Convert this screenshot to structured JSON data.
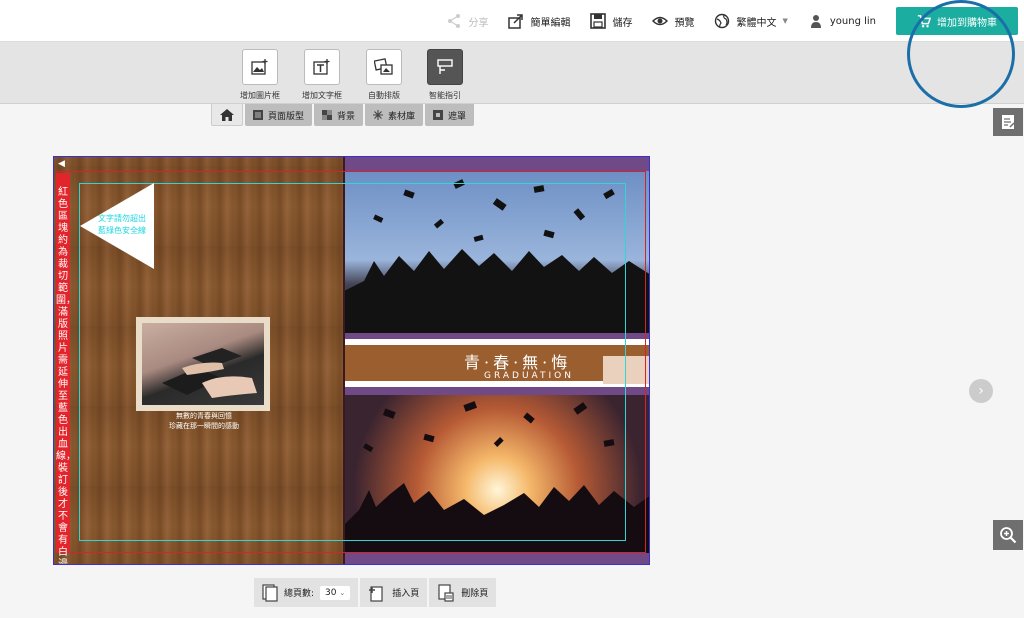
{
  "header": {
    "share_label": "分享",
    "quick_edit_label": "簡單編輯",
    "save_label": "儲存",
    "preview_label": "預覽",
    "language_label": "繁體中文",
    "user_name": "young lin",
    "cart_label": "增加到購物車"
  },
  "toolbar": {
    "add_image_label": "增加圖片框",
    "add_text_label": "增加文字框",
    "auto_layout_label": "自動排版",
    "smart_guide_label": "智能指引"
  },
  "tabs": {
    "layout_label": "頁面版型",
    "background_label": "背景",
    "materials_label": "素材庫",
    "mask_label": "遮罩"
  },
  "canvas": {
    "warning_text": "紅色區塊約為裁切範圍，滿版照片需延伸至藍色出血線，裝訂後才不會有白邊",
    "safe_note_line1": "文字請勿超出",
    "safe_note_line2": "藍綠色安全線",
    "caption_line1": "無數的青春與回憶",
    "caption_line2": "珍藏在那一瞬間的感動",
    "title": "青·春·無·悔",
    "subtitle": "GRADUATION"
  },
  "bottom": {
    "total_pages_label": "總頁數:",
    "total_pages_value": "30",
    "insert_label": "插入頁",
    "delete_label": "刪除頁"
  },
  "colors": {
    "accent": "#1aada0",
    "bleed_line": "#3a2fd0",
    "cut_line": "#d0262b",
    "safe_line": "#2fd6d8"
  }
}
